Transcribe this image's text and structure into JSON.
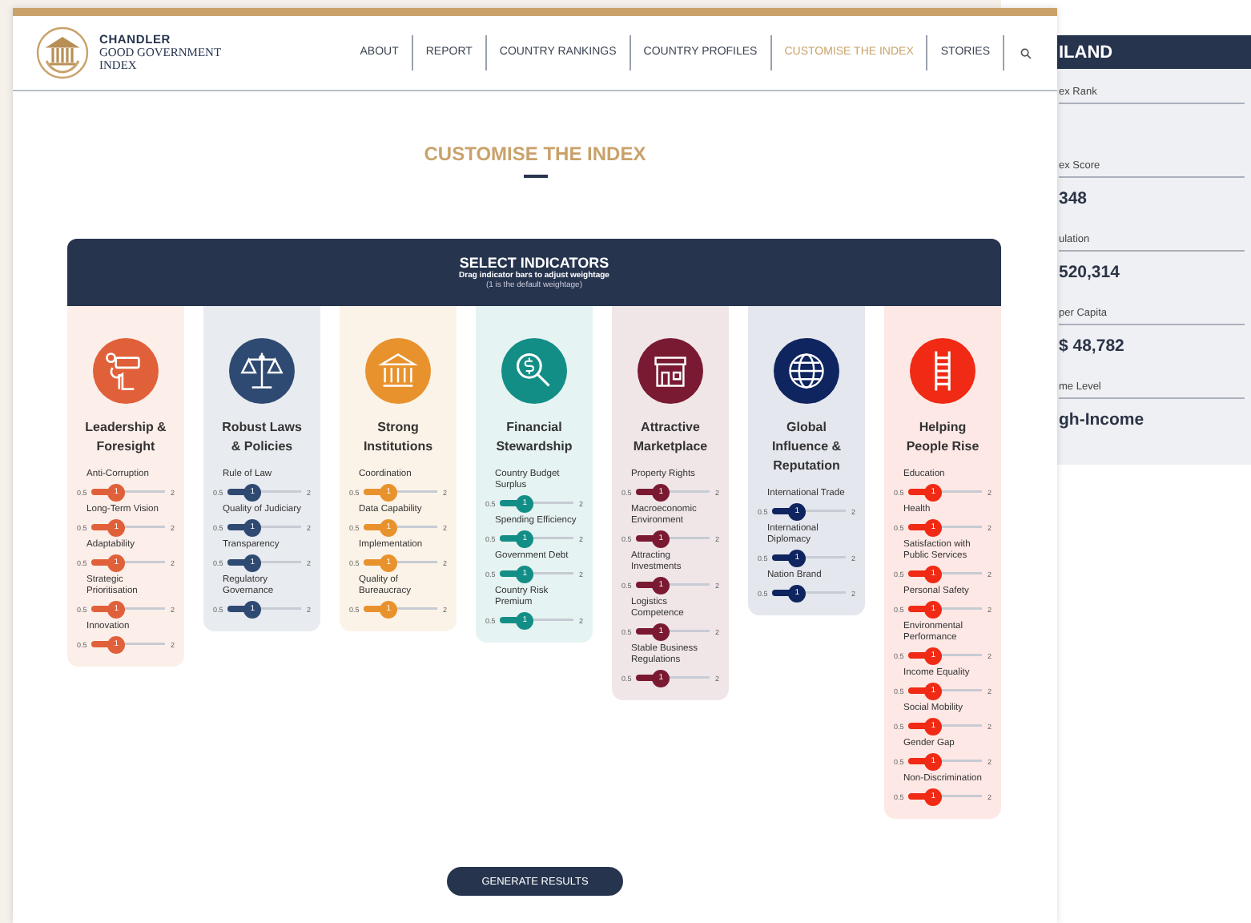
{
  "side_panel": {
    "title": "ILAND",
    "fields": [
      {
        "label": "ex Rank"
      },
      {
        "label": "ex Score",
        "value": "348"
      },
      {
        "label": "ulation",
        "value": "520,314"
      },
      {
        "label": "per Capita",
        "value": "$ 48,782"
      },
      {
        "label": "me Level",
        "value": "gh-Income"
      }
    ]
  },
  "logo": {
    "name": "CHANDLER",
    "subtitle_lines": [
      "GOOD GOVERNMENT",
      "INDEX"
    ]
  },
  "nav": [
    {
      "label": "ABOUT",
      "selected": false
    },
    {
      "label": "REPORT",
      "selected": false
    },
    {
      "label": "COUNTRY RANKINGS",
      "selected": false
    },
    {
      "label": "COUNTRY PROFILES",
      "selected": false
    },
    {
      "label": "CUSTOMISE THE INDEX",
      "selected": true
    },
    {
      "label": "STORIES",
      "selected": false
    }
  ],
  "page_title": "CUSTOMISE THE INDEX",
  "selector": {
    "title": "SELECT INDICATORS",
    "subtitle": "Drag indicator bars to adjust weightage",
    "note": "(1 is the default weightage)"
  },
  "pillars": [
    {
      "title": "Leadership & Foresight",
      "color": "#e0603a",
      "indicators": [
        {
          "label": "Anti-Corruption",
          "min": "0.5",
          "max": "2",
          "value": "1",
          "level": 0.333
        },
        {
          "label": "Long-Term Vision",
          "min": "0.5",
          "max": "2",
          "value": "1",
          "level": 0.333
        },
        {
          "label": "Adaptability",
          "min": "0.5",
          "max": "2",
          "value": "1",
          "level": 0.333
        },
        {
          "label": "Strategic Prioritisation",
          "min": "0.5",
          "max": "2",
          "value": "1",
          "level": 0.333
        },
        {
          "label": "Innovation",
          "min": "0.5",
          "max": "2",
          "value": "1",
          "level": 0.333
        }
      ]
    },
    {
      "title": "Robust Laws & Policies",
      "color": "#2f4a72",
      "indicators": [
        {
          "label": "Rule of Law",
          "min": "0.5",
          "max": "2",
          "value": "1",
          "level": 0.333
        },
        {
          "label": "Quality of Judiciary",
          "min": "0.5",
          "max": "2",
          "value": "1",
          "level": 0.333
        },
        {
          "label": "Transparency",
          "min": "0.5",
          "max": "2",
          "value": "1",
          "level": 0.333
        },
        {
          "label": "Regulatory Governance",
          "min": "0.5",
          "max": "2",
          "value": "1",
          "level": 0.333
        }
      ]
    },
    {
      "title": "Strong Institutions",
      "color": "#e8922e",
      "indicators": [
        {
          "label": "Coordination",
          "min": "0.5",
          "max": "2",
          "value": "1",
          "level": 0.333
        },
        {
          "label": "Data Capability",
          "min": "0.5",
          "max": "2",
          "value": "1",
          "level": 0.333
        },
        {
          "label": "Implementation",
          "min": "0.5",
          "max": "2",
          "value": "1",
          "level": 0.333
        },
        {
          "label": "Quality of Bureaucracy",
          "min": "0.5",
          "max": "2",
          "value": "1",
          "level": 0.333
        }
      ]
    },
    {
      "title": "Financial Stewardship",
      "color": "#138e86",
      "indicators": [
        {
          "label": "Country Budget Surplus",
          "min": "0.5",
          "max": "2",
          "value": "1",
          "level": 0.333
        },
        {
          "label": "Spending Efficiency",
          "min": "0.5",
          "max": "2",
          "value": "1",
          "level": 0.333
        },
        {
          "label": "Government Debt",
          "min": "0.5",
          "max": "2",
          "value": "1",
          "level": 0.333
        },
        {
          "label": "Country Risk Premium",
          "min": "0.5",
          "max": "2",
          "value": "1",
          "level": 0.333
        }
      ]
    },
    {
      "title": "Attractive Marketplace",
      "color": "#7a1a32",
      "indicators": [
        {
          "label": "Property Rights",
          "min": "0.5",
          "max": "2",
          "value": "1",
          "level": 0.333
        },
        {
          "label": "Macroeconomic Environment",
          "min": "0.5",
          "max": "2",
          "value": "1",
          "level": 0.333
        },
        {
          "label": "Attracting Investments",
          "min": "0.5",
          "max": "2",
          "value": "1",
          "level": 0.333
        },
        {
          "label": "Logistics Competence",
          "min": "0.5",
          "max": "2",
          "value": "1",
          "level": 0.333
        },
        {
          "label": "Stable Business Regulations",
          "min": "0.5",
          "max": "2",
          "value": "1",
          "level": 0.333
        }
      ]
    },
    {
      "title": "Global Influence & Reputation",
      "color": "#0f2560",
      "indicators": [
        {
          "label": "International Trade",
          "min": "0.5",
          "max": "2",
          "value": "1",
          "level": 0.333
        },
        {
          "label": "International Diplomacy",
          "min": "0.5",
          "max": "2",
          "value": "1",
          "level": 0.333
        },
        {
          "label": "Nation Brand",
          "min": "0.5",
          "max": "2",
          "value": "1",
          "level": 0.333
        }
      ]
    },
    {
      "title": "Helping People Rise",
      "color": "#f02a14",
      "indicators": [
        {
          "label": "Education",
          "min": "0.5",
          "max": "2",
          "value": "1",
          "level": 0.333
        },
        {
          "label": "Health",
          "min": "0.5",
          "max": "2",
          "value": "1",
          "level": 0.333
        },
        {
          "label": "Satisfaction with Public Services",
          "min": "0.5",
          "max": "2",
          "value": "1",
          "level": 0.333
        },
        {
          "label": "Personal Safety",
          "min": "0.5",
          "max": "2",
          "value": "1",
          "level": 0.333
        },
        {
          "label": "Environmental Performance",
          "min": "0.5",
          "max": "2",
          "value": "1",
          "level": 0.333
        },
        {
          "label": "Income Equality",
          "min": "0.5",
          "max": "2",
          "value": "1",
          "level": 0.333
        },
        {
          "label": "Social Mobility",
          "min": "0.5",
          "max": "2",
          "value": "1",
          "level": 0.333
        },
        {
          "label": "Gender Gap",
          "min": "0.5",
          "max": "2",
          "value": "1",
          "level": 0.333
        },
        {
          "label": "Non-Discrimination",
          "min": "0.5",
          "max": "2",
          "value": "1",
          "level": 0.333
        }
      ]
    }
  ],
  "action_button": "GENERATE RESULTS"
}
